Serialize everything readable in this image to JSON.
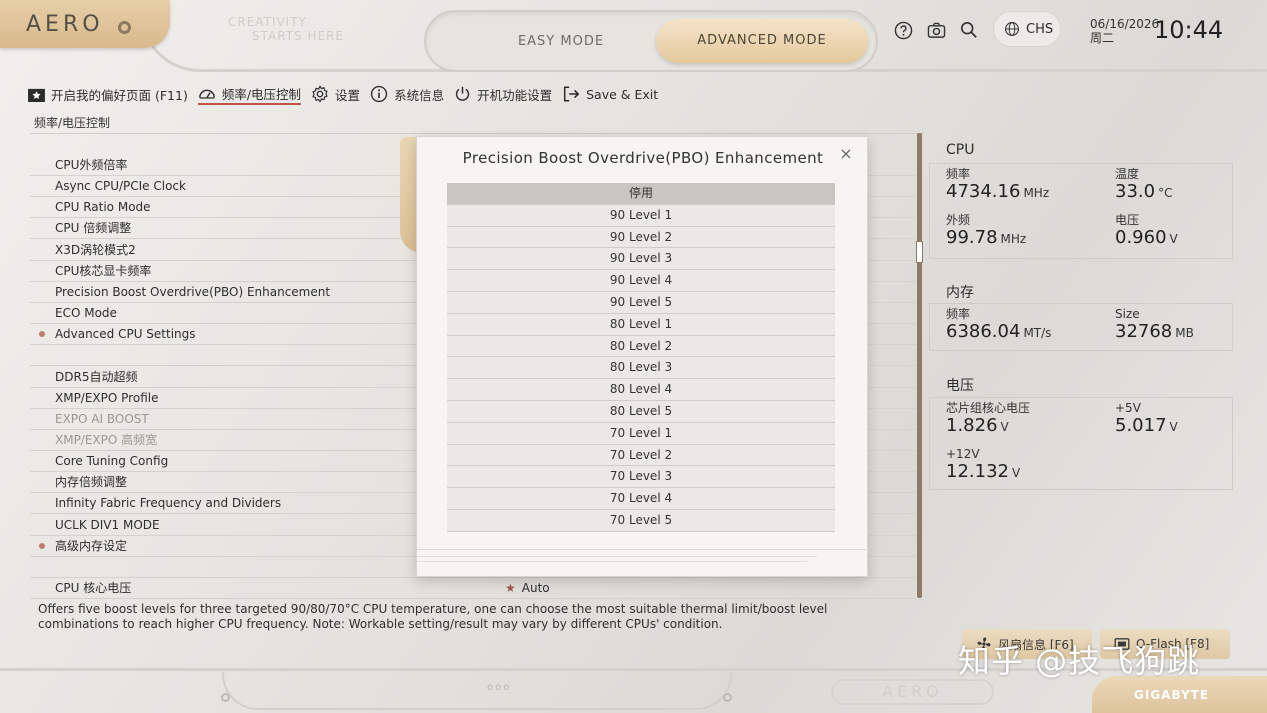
{
  "header": {
    "logo": "AERO",
    "slogan_line1": "CREATIVITY",
    "slogan_line2": "STARTS HERE",
    "mode_easy": "EASY MODE",
    "mode_advanced": "ADVANCED MODE",
    "language": "CHS",
    "date": "06/16/2026",
    "weekday": "周二",
    "time": "10:44"
  },
  "nav": {
    "favorites": "开启我的偏好页面 (F11)",
    "freq_voltage": "频率/电压控制",
    "settings": "设置",
    "system_info": "系统信息",
    "boot": "开机功能设置",
    "save_exit": "Save & Exit"
  },
  "section_title": "频率/电压控制",
  "settings": {
    "rows": [
      {
        "label": "CPU外频倍率",
        "disabled": false,
        "bullet": false,
        "value": ""
      },
      {
        "label": "Async CPU/PCIe Clock",
        "disabled": false,
        "bullet": false,
        "value": ""
      },
      {
        "label": "CPU Ratio Mode",
        "disabled": false,
        "bullet": false,
        "value": ""
      },
      {
        "label": "CPU 倍频调整",
        "disabled": false,
        "bullet": false,
        "value": ""
      },
      {
        "label": "X3D涡轮模式2",
        "disabled": false,
        "bullet": false,
        "value": ""
      },
      {
        "label": "CPU核芯显卡频率",
        "disabled": false,
        "bullet": false,
        "value": ""
      },
      {
        "label": "Precision Boost Overdrive(PBO) Enhancement",
        "disabled": false,
        "bullet": false,
        "value": ""
      },
      {
        "label": "ECO Mode",
        "disabled": false,
        "bullet": false,
        "value": ""
      },
      {
        "label": "Advanced CPU Settings",
        "disabled": false,
        "bullet": true,
        "value": ""
      },
      {
        "label": "",
        "disabled": false,
        "bullet": false,
        "value": ""
      },
      {
        "label": "DDR5自动超频",
        "disabled": false,
        "bullet": false,
        "value": ""
      },
      {
        "label": "XMP/EXPO Profile",
        "disabled": false,
        "bullet": false,
        "value": ""
      },
      {
        "label": "EXPO AI BOOST",
        "disabled": true,
        "bullet": false,
        "value": ""
      },
      {
        "label": "XMP/EXPO 高频宽",
        "disabled": true,
        "bullet": false,
        "value": ""
      },
      {
        "label": "Core Tuning Config",
        "disabled": false,
        "bullet": false,
        "value": ""
      },
      {
        "label": "内存倍频调整",
        "disabled": false,
        "bullet": false,
        "value": ""
      },
      {
        "label": "Infinity Fabric Frequency and Dividers",
        "disabled": false,
        "bullet": false,
        "value": ""
      },
      {
        "label": "UCLK DIV1 MODE",
        "disabled": false,
        "bullet": false,
        "value": ""
      },
      {
        "label": "高级内存设定",
        "disabled": false,
        "bullet": true,
        "value": ""
      },
      {
        "label": "",
        "disabled": false,
        "bullet": false,
        "value": ""
      },
      {
        "label": "CPU 核心电压",
        "disabled": false,
        "bullet": false,
        "value": "Auto"
      }
    ]
  },
  "help_text": "Offers five boost levels for three targeted 90/80/70°C CPU temperature, one can choose the most suitable thermal limit/boost level combinations to reach higher CPU frequency. Note: Workable setting/result may vary by different CPUs' condition.",
  "popup": {
    "title": "Precision Boost Overdrive(PBO) Enhancement",
    "close": "×",
    "options": [
      "停用",
      "90 Level 1",
      "90 Level 2",
      "90 Level 3",
      "90 Level 4",
      "90 Level 5",
      "80 Level 1",
      "80 Level 2",
      "80 Level 3",
      "80 Level 4",
      "80 Level 5",
      "70 Level 1",
      "70 Level 2",
      "70 Level 3",
      "70 Level 4",
      "70 Level 5"
    ],
    "selected": "停用"
  },
  "info": {
    "cpu": {
      "title": "CPU",
      "freq_label": "频率",
      "freq_value": "4734.16",
      "freq_unit": "MHz",
      "temp_label": "温度",
      "temp_value": "33.0",
      "temp_unit": "°C",
      "bclk_label": "外频",
      "bclk_value": "99.78",
      "bclk_unit": "MHz",
      "volt_label": "电压",
      "volt_value": "0.960",
      "volt_unit": "V"
    },
    "memory": {
      "title": "内存",
      "freq_label": "频率",
      "freq_value": "6386.04",
      "freq_unit": "MT/s",
      "size_label": "Size",
      "size_value": "32768",
      "size_unit": "MB"
    },
    "voltage": {
      "title": "电压",
      "chipset_label": "芯片组核心电压",
      "chipset_value": "1.826",
      "chipset_unit": "V",
      "p5v_label": "+5V",
      "p5v_value": "5.017",
      "p5v_unit": "V",
      "p12v_label": "+12V",
      "p12v_value": "12.132",
      "p12v_unit": "V"
    }
  },
  "footer": {
    "fan_button": "风扇信息 [F6]",
    "qflash_button": "Q-Flash [F8]",
    "aero_badge": "AERO",
    "brand": "GIGABYTE",
    "dots": "ooo",
    "watermark": "知乎 @技飞狗跳"
  },
  "colors": {
    "accent_gold": "#dcbf93",
    "active_underline": "#c0544a",
    "selected_option": "#c9c6c1",
    "scrollbar": "#8e7a66"
  }
}
